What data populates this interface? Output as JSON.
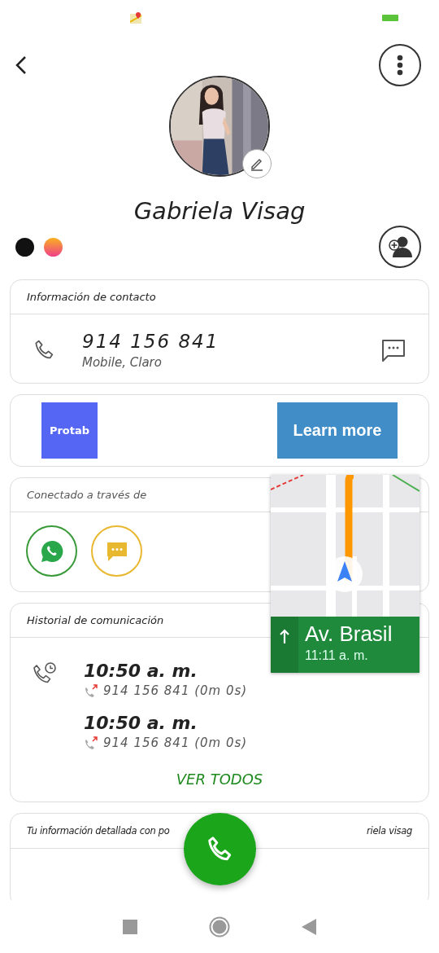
{
  "contact": {
    "name": "Gabriela Visag"
  },
  "contact_info": {
    "title": "Información de contacto",
    "phone": "914 156 841",
    "detail": "Mobile, Claro"
  },
  "ad": {
    "brand": "Protab",
    "button": "Learn more"
  },
  "connected": {
    "title": "Conectado a través de",
    "apps": [
      {
        "kind": "whatsapp"
      },
      {
        "kind": "sms"
      }
    ]
  },
  "history": {
    "title": "Historial de comunicación",
    "entries": [
      {
        "time": "10:50 a. m.",
        "detail": "914 156 841 (0m 0s)"
      },
      {
        "time": "10:50 a. m.",
        "detail": "914 156 841 (0m 0s)"
      }
    ],
    "link": "VER TODOS"
  },
  "insights": {
    "title_start": "Tu información detallada con po",
    "title_end": "riela visag"
  },
  "navigation": {
    "street": "Av. Brasil",
    "eta": "11:11 a. m."
  }
}
